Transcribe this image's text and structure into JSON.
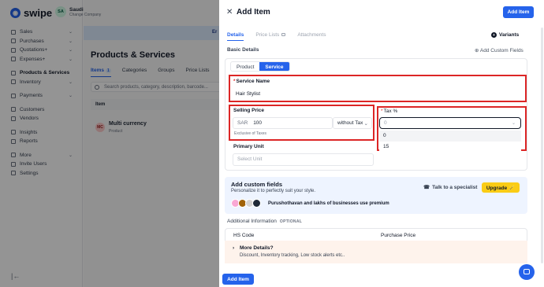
{
  "brand": {
    "name": "swipe"
  },
  "company": {
    "avatar": "SA",
    "name": "Saudi",
    "switch_label": "Change Company"
  },
  "sidebar": {
    "items": [
      {
        "label": "Sales",
        "icon": "cart-icon",
        "chevron": "⌄"
      },
      {
        "label": "Purchases",
        "icon": "bag-icon",
        "chevron": "⌄"
      },
      {
        "label": "Quotations+",
        "icon": "file-icon",
        "chevron": "⌄"
      },
      {
        "label": "Expenses+",
        "icon": "wallet-icon",
        "chevron": "⌄"
      },
      {
        "label": "Products & Services",
        "icon": "box-icon",
        "chevron": ""
      },
      {
        "label": "Inventory",
        "icon": "warehouse-icon",
        "chevron": "⌄"
      },
      {
        "label": "Payments",
        "icon": "card-icon",
        "chevron": "⌄"
      },
      {
        "label": "Customers",
        "icon": "users-icon",
        "chevron": ""
      },
      {
        "label": "Vendors",
        "icon": "truck-icon",
        "chevron": ""
      },
      {
        "label": "Insights",
        "icon": "chart-icon",
        "chevron": ""
      },
      {
        "label": "Reports",
        "icon": "report-icon",
        "chevron": ""
      },
      {
        "label": "More",
        "icon": "grid-icon",
        "chevron": "⌄"
      },
      {
        "label": "Invite Users",
        "icon": "user-plus-icon",
        "chevron": ""
      },
      {
        "label": "Settings",
        "icon": "gear-icon",
        "chevron": ""
      }
    ],
    "collapse_glyph": "|←"
  },
  "background": {
    "banner_text": "Er",
    "page_title": "Products & Services",
    "tabs": [
      "Items",
      "Categories",
      "Groups",
      "Price Lists"
    ],
    "items_count": "1",
    "search_placeholder": "Search products, category, description, barcode...",
    "column_header": "Item",
    "product": {
      "avatar": "MC",
      "name": "Multi currency",
      "type": "Product"
    }
  },
  "drawer": {
    "close_glyph": "✕",
    "title": "Add Item",
    "add_button": "Add Item",
    "tabs": [
      "Details",
      "Price Lists",
      "Attachments"
    ],
    "variants_label": "Variants",
    "variants_glyph": "+",
    "basic_details": "Basic Details",
    "add_custom_fields": "⊕ Add Custom Fields",
    "item_types": [
      "Product",
      "Service"
    ],
    "service_name_label": "Service Name",
    "service_name_value": "Hair Stylist",
    "selling_price_label": "Selling Price",
    "currency": "SAR",
    "selling_price_value": "100",
    "tax_mode": "without Tax",
    "tax_mode_chevron": "⌄",
    "exclusive_note": "Exclusive of Taxes",
    "tax_label": "Tax %",
    "tax_value": "0",
    "tax_chevron": "⌄",
    "tax_options": [
      "0",
      "15"
    ],
    "primary_unit_label": "Primary Unit",
    "primary_unit_placeholder": "Select Unit",
    "required_mark": "*",
    "promo": {
      "title": "Add custom fields",
      "subtitle": "Personalize it to perfectly suit your style.",
      "users_text": "Purushothavan and lakhs of businesses use premium",
      "talk_label": "Talk to a specialist",
      "talk_icon": "headset-icon",
      "upgrade_label": "Upgrade 🪄"
    },
    "additional_label": "Additional Information",
    "optional_tag": "OPTIONAL",
    "hs_code_label": "HS Code",
    "purchase_price_label": "Purchase Price",
    "more_details_glyph": "›",
    "more_details_title": "More Details?",
    "more_details_sub": "Discount, Inventory tracking, Low stock alerts etc..",
    "bottom_add_button": "Add Item"
  },
  "colors": {
    "accent": "#2563eb",
    "highlight": "#dc2626",
    "upgrade": "#facc15"
  }
}
